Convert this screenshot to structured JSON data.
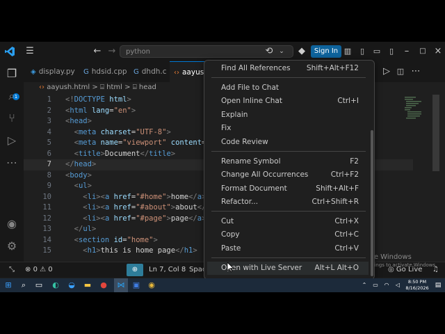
{
  "titlebar": {
    "search_placeholder": "python",
    "sign_in": "Sign In"
  },
  "activity": {
    "badge": "1"
  },
  "tabs": [
    {
      "icon": "py-icon",
      "label": "display.py"
    },
    {
      "icon": "cpp-icon",
      "label": "hdsid.cpp"
    },
    {
      "icon": "c-icon",
      "label": "dhdh.c"
    },
    {
      "icon": "html-icon",
      "label": "aayus"
    }
  ],
  "breadcrumb": {
    "file": "aayush.html",
    "sep1": ">",
    "item1": "html",
    "sep2": ">",
    "item2": "head"
  },
  "editor": {
    "lines": [
      {
        "num": "1",
        "indent": "",
        "parts": [
          [
            "t-br",
            "<!"
          ],
          [
            "t-tag",
            "DOCTYPE"
          ],
          [
            "t-txt",
            " "
          ],
          [
            "t-attr",
            "html"
          ],
          [
            "t-br",
            ">"
          ]
        ]
      },
      {
        "num": "2",
        "indent": "",
        "parts": [
          [
            "t-br",
            "<"
          ],
          [
            "t-tag",
            "html"
          ],
          [
            "t-txt",
            " "
          ],
          [
            "t-attr",
            "lang"
          ],
          [
            "t-txt",
            "="
          ],
          [
            "t-str",
            "\"en\""
          ],
          [
            "t-br",
            ">"
          ]
        ]
      },
      {
        "num": "3",
        "indent": "",
        "parts": [
          [
            "t-br",
            "<"
          ],
          [
            "t-tag",
            "head"
          ],
          [
            "t-br",
            ">"
          ]
        ]
      },
      {
        "num": "4",
        "indent": "  ",
        "parts": [
          [
            "t-br",
            "<"
          ],
          [
            "t-tag",
            "meta"
          ],
          [
            "t-txt",
            " "
          ],
          [
            "t-attr",
            "charset"
          ],
          [
            "t-txt",
            "="
          ],
          [
            "t-str",
            "\"UTF-8\""
          ],
          [
            "t-br",
            ">"
          ]
        ]
      },
      {
        "num": "5",
        "indent": "  ",
        "parts": [
          [
            "t-br",
            "<"
          ],
          [
            "t-tag",
            "meta"
          ],
          [
            "t-txt",
            " "
          ],
          [
            "t-attr",
            "name"
          ],
          [
            "t-txt",
            "="
          ],
          [
            "t-str",
            "\"viewport\""
          ],
          [
            "t-txt",
            " "
          ],
          [
            "t-attr",
            "content"
          ],
          [
            "t-txt",
            "="
          ],
          [
            "t-str",
            "\""
          ]
        ]
      },
      {
        "num": "6",
        "indent": "  ",
        "parts": [
          [
            "t-br",
            "<"
          ],
          [
            "t-tag",
            "title"
          ],
          [
            "t-br",
            ">"
          ],
          [
            "t-txt",
            "Document"
          ],
          [
            "t-br",
            "</"
          ],
          [
            "t-tag",
            "title"
          ],
          [
            "t-br",
            ">"
          ]
        ]
      },
      {
        "num": "7",
        "indent": "",
        "parts": [
          [
            "t-br",
            "</"
          ],
          [
            "t-tag",
            "head"
          ],
          [
            "t-br",
            ">"
          ]
        ]
      },
      {
        "num": "8",
        "indent": "",
        "parts": [
          [
            "t-br",
            "<"
          ],
          [
            "t-tag",
            "body"
          ],
          [
            "t-br",
            ">"
          ]
        ]
      },
      {
        "num": "9",
        "indent": "  ",
        "parts": [
          [
            "t-br",
            "<"
          ],
          [
            "t-tag",
            "ul"
          ],
          [
            "t-br",
            ">"
          ]
        ]
      },
      {
        "num": "10",
        "indent": "    ",
        "parts": [
          [
            "t-br",
            "<"
          ],
          [
            "t-tag",
            "li"
          ],
          [
            "t-br",
            "><"
          ],
          [
            "t-tag",
            "a"
          ],
          [
            "t-txt",
            " "
          ],
          [
            "t-attr",
            "href"
          ],
          [
            "t-txt",
            "="
          ],
          [
            "t-str",
            "\"#home\""
          ],
          [
            "t-br",
            ">"
          ],
          [
            "t-txt",
            "home"
          ],
          [
            "t-br",
            "</"
          ],
          [
            "t-tag",
            "a"
          ],
          [
            "t-br",
            ">"
          ]
        ]
      },
      {
        "num": "11",
        "indent": "    ",
        "parts": [
          [
            "t-br",
            "<"
          ],
          [
            "t-tag",
            "li"
          ],
          [
            "t-br",
            "><"
          ],
          [
            "t-tag",
            "a"
          ],
          [
            "t-txt",
            " "
          ],
          [
            "t-attr",
            "href"
          ],
          [
            "t-txt",
            "="
          ],
          [
            "t-str",
            "\"#about\""
          ],
          [
            "t-br",
            ">"
          ],
          [
            "t-txt",
            "about"
          ],
          [
            "t-br",
            "</"
          ],
          [
            "t-tag",
            "a"
          ]
        ]
      },
      {
        "num": "12",
        "indent": "    ",
        "parts": [
          [
            "t-br",
            "<"
          ],
          [
            "t-tag",
            "li"
          ],
          [
            "t-br",
            "><"
          ],
          [
            "t-tag",
            "a"
          ],
          [
            "t-txt",
            " "
          ],
          [
            "t-attr",
            "href"
          ],
          [
            "t-txt",
            "="
          ],
          [
            "t-str",
            "\"#page\""
          ],
          [
            "t-br",
            ">"
          ],
          [
            "t-txt",
            "page"
          ],
          [
            "t-br",
            "</"
          ],
          [
            "t-tag",
            "a"
          ],
          [
            "t-br",
            ">"
          ]
        ]
      },
      {
        "num": "13",
        "indent": "  ",
        "parts": [
          [
            "t-br",
            "</"
          ],
          [
            "t-tag",
            "ul"
          ],
          [
            "t-br",
            ">"
          ]
        ]
      },
      {
        "num": "14",
        "indent": "  ",
        "parts": [
          [
            "t-br",
            "<"
          ],
          [
            "t-tag",
            "section"
          ],
          [
            "t-txt",
            " "
          ],
          [
            "t-attr",
            "id"
          ],
          [
            "t-txt",
            "="
          ],
          [
            "t-str",
            "\"home\""
          ],
          [
            "t-br",
            ">"
          ]
        ]
      },
      {
        "num": "15",
        "indent": "    ",
        "parts": [
          [
            "t-br",
            "<"
          ],
          [
            "t-tag",
            "h1"
          ],
          [
            "t-br",
            ">"
          ],
          [
            "t-txt",
            "this is home page"
          ],
          [
            "t-br",
            "</"
          ],
          [
            "t-tag",
            "h1"
          ],
          [
            "t-br",
            ">"
          ]
        ]
      }
    ]
  },
  "context_menu": {
    "items": [
      {
        "label": "Find All References",
        "key": "Shift+Alt+F12"
      },
      {
        "label": "Add File to Chat",
        "key": ""
      },
      {
        "label": "Open Inline Chat",
        "key": "Ctrl+I"
      },
      {
        "label": "Explain",
        "key": ""
      },
      {
        "label": "Fix",
        "key": ""
      },
      {
        "label": "Code Review",
        "key": ""
      },
      {
        "label": "Rename Symbol",
        "key": "F2"
      },
      {
        "label": "Change All Occurrences",
        "key": "Ctrl+F2"
      },
      {
        "label": "Format Document",
        "key": "Shift+Alt+F"
      },
      {
        "label": "Refactor...",
        "key": "Ctrl+Shift+R"
      },
      {
        "label": "Cut",
        "key": "Ctrl+X"
      },
      {
        "label": "Copy",
        "key": "Ctrl+C"
      },
      {
        "label": "Paste",
        "key": "Ctrl+V"
      },
      {
        "label": "Open with Live Server",
        "key": "Alt+L Alt+O"
      }
    ]
  },
  "statusbar": {
    "problems": "0",
    "warnings": "0",
    "position": "Ln 7, Col 8",
    "spaces": "Spac",
    "golive": "Go Live"
  },
  "watermark": {
    "title": "Activate Windows",
    "subtitle": "Go to Settings to activate Windows."
  },
  "taskbar": {
    "time": "8:50 PM",
    "date": "8/16/2026"
  }
}
